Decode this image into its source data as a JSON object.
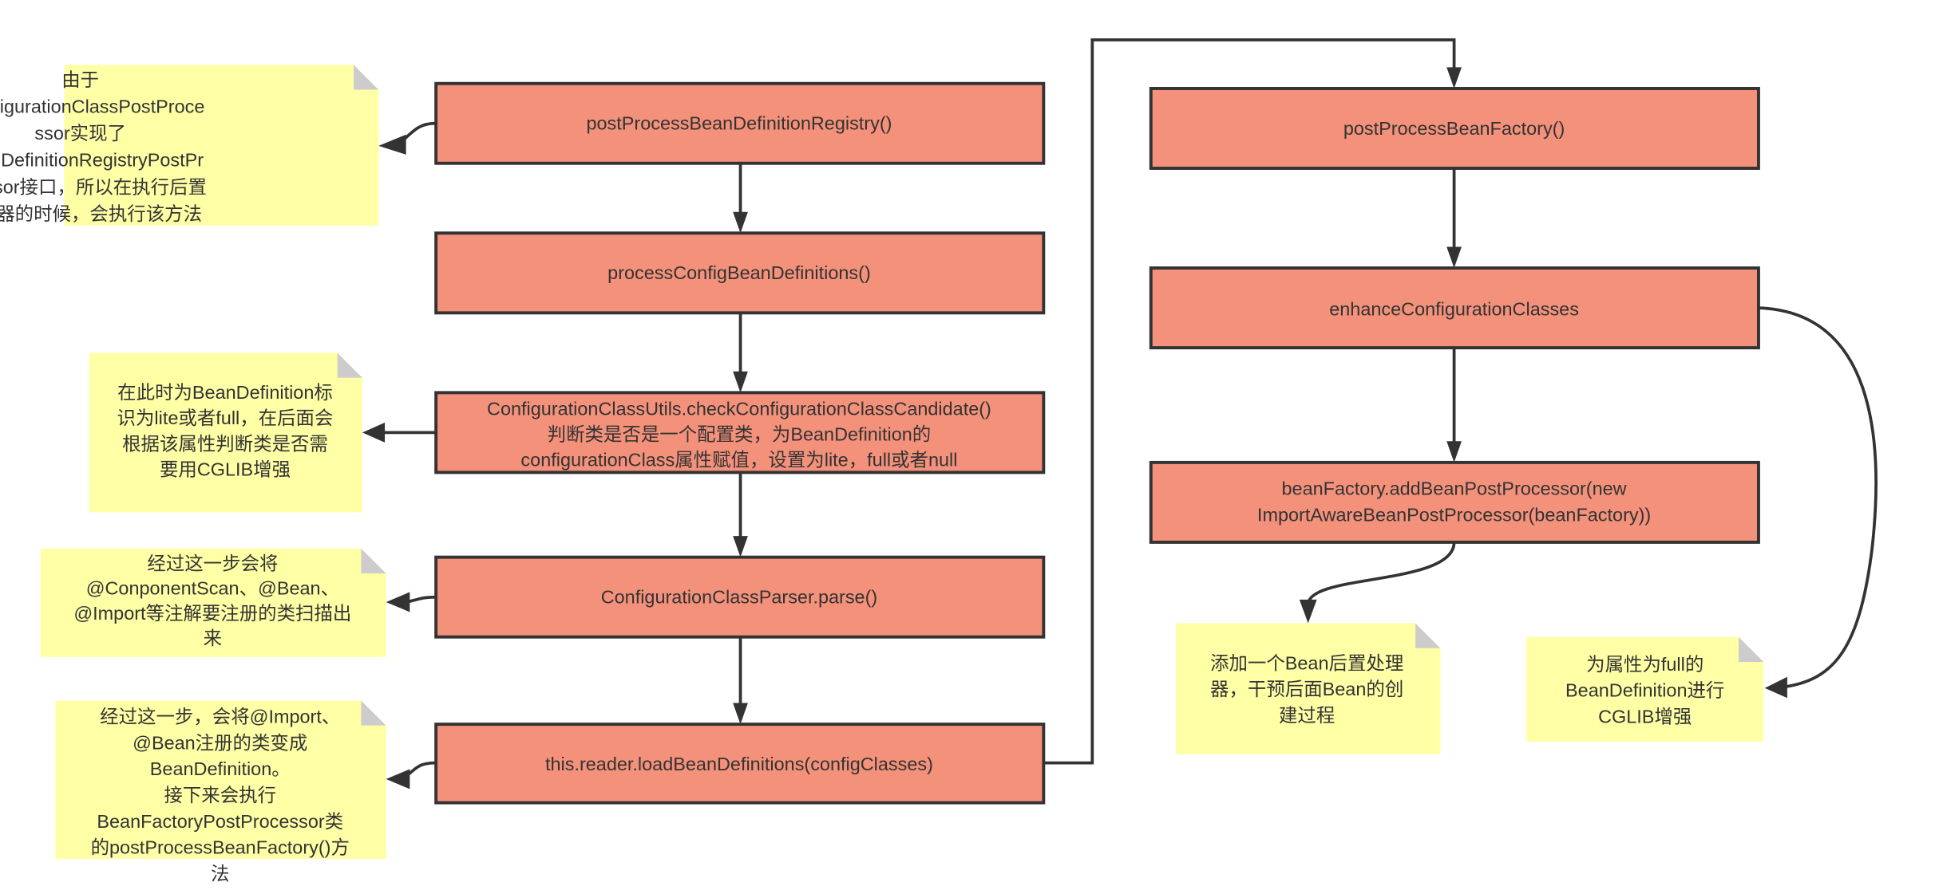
{
  "colors": {
    "process_fill": "#f4917b",
    "note_fill": "#ffffa6",
    "stroke": "#333333",
    "fold": "#cccccc"
  },
  "process_nodes": [
    {
      "id": "p1",
      "lines": [
        "postProcessBeanDefinitionRegistry()"
      ]
    },
    {
      "id": "p2",
      "lines": [
        "processConfigBeanDefinitions()"
      ]
    },
    {
      "id": "p3",
      "lines": [
        "ConfigurationClassUtils.checkConfigurationClassCandidate()",
        "判断类是否是一个配置类，为BeanDefinition的",
        "configurationClass属性赋值，设置为lite，full或者null"
      ]
    },
    {
      "id": "p4",
      "lines": [
        "ConfigurationClassParser.parse()"
      ]
    },
    {
      "id": "p5",
      "lines": [
        "this.reader.loadBeanDefinitions(configClasses)"
      ]
    },
    {
      "id": "p6",
      "lines": [
        "postProcessBeanFactory()"
      ]
    },
    {
      "id": "p7",
      "lines": [
        "enhanceConfigurationClasses"
      ]
    },
    {
      "id": "p8",
      "lines": [
        "beanFactory.addBeanPostProcessor(new",
        "ImportAwareBeanPostProcessor(beanFactory))"
      ]
    }
  ],
  "notes": [
    {
      "id": "n1",
      "lines": [
        "由于",
        "COnfigurationClassPostProce",
        "ssor实现了",
        "BeanDefinitionRegistryPostPr",
        "ocessor接口，所以在执行后置",
        "处理器的时候，会执行该方法"
      ]
    },
    {
      "id": "n2",
      "lines": [
        "在此时为BeanDefinition标",
        "识为lite或者full，在后面会",
        "根据该属性判断类是否需",
        "要用CGLIB增强"
      ]
    },
    {
      "id": "n3",
      "lines": [
        "经过这一步会将",
        "@ConponentScan、@Bean、",
        "@Import等注解要注册的类扫描出",
        "来"
      ]
    },
    {
      "id": "n4",
      "lines": [
        "经过这一步，会将@Import、",
        "@Bean注册的类变成",
        "BeanDefinition。",
        "接下来会执行",
        "BeanFactoryPostProcessor类",
        "的postProcessBeanFactory()方",
        "法"
      ]
    },
    {
      "id": "n5",
      "lines": [
        "添加一个Bean后置处理",
        "器，干预后面Bean的创",
        "建过程"
      ]
    },
    {
      "id": "n6",
      "lines": [
        "为属性为full的",
        "BeanDefinition进行",
        "CGLIB增强"
      ]
    }
  ],
  "edges": [
    {
      "from": "p1",
      "to": "p2"
    },
    {
      "from": "p2",
      "to": "p3"
    },
    {
      "from": "p3",
      "to": "p4"
    },
    {
      "from": "p4",
      "to": "p5"
    },
    {
      "from": "p5",
      "to": "p6"
    },
    {
      "from": "p6",
      "to": "p7"
    },
    {
      "from": "p7",
      "to": "p8"
    },
    {
      "from": "p1",
      "to": "n1"
    },
    {
      "from": "p3",
      "to": "n2"
    },
    {
      "from": "p4",
      "to": "n3"
    },
    {
      "from": "p5",
      "to": "n4"
    },
    {
      "from": "p8",
      "to": "n5"
    },
    {
      "from": "p7",
      "to": "n6"
    }
  ]
}
